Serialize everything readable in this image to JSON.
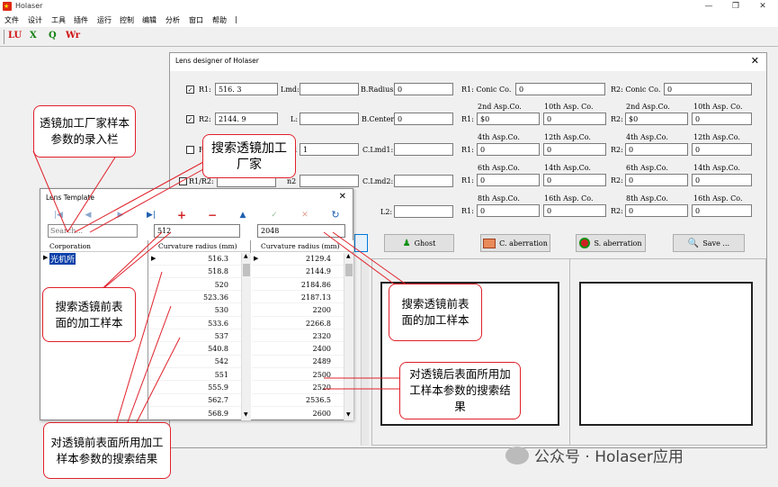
{
  "app": {
    "title": "Holaser"
  },
  "window_controls": {
    "minimize": "—",
    "restore": "❐",
    "close": "✕"
  },
  "menu": [
    "文件",
    "设计",
    "工具",
    "插件",
    "运行",
    "控制",
    "编辑",
    "分析",
    "窗口",
    "帮助",
    "|"
  ],
  "toolbar": [
    {
      "label": "LU",
      "color": "#d01010"
    },
    {
      "label": "X",
      "color": "#108010"
    },
    {
      "label": "Q",
      "color": "#108010"
    },
    {
      "label": "Wr",
      "color": "#d01010"
    }
  ],
  "lens_designer": {
    "title": "Lens designer of Holaser",
    "close": "✕",
    "r1_label": "R1:",
    "r1_value": "516. 3",
    "r1_checked": true,
    "r2_label": "R2:",
    "r2_value": "2144. 9",
    "r2_checked": true,
    "f_label": "F",
    "r1r2_label": "R1/R2:",
    "lmd_label": "Lmd:",
    "l_label": "L:",
    "n1_label": "n1",
    "n1_value": "1",
    "n2_label": "n2",
    "l2_label": "L2:",
    "bradius_label": "B.Radius:",
    "bradius_value": "0",
    "bcenter_label": "B.Center:",
    "bcenter_value": "0",
    "clmd1_label": "C.Lmd1:",
    "clmd2_label": "C.Lmd2:",
    "r1_conic_label": "R1: Conic Co.",
    "r1_conic_value": "0",
    "r2_conic_label": "R2: Conic Co.",
    "r2_conic_value": "0",
    "asp": {
      "r1": "R1:",
      "r2": "R2:",
      "h2": "2nd Asp.Co.",
      "h10": "10th Asp. Co.",
      "h4": "4th Asp.Co.",
      "h12": "12th Asp.Co.",
      "h6": "6th Asp.Co.",
      "h14": "14th Asp.Co.",
      "h8": "8th Asp.Co.",
      "h16": "16th Asp. Co.",
      "v_dollar": "$0",
      "v0": "0"
    },
    "buttons": {
      "ghost": "Ghost",
      "c_aberration": "C. aberration",
      "s_aberration": "S. aberration",
      "save": "Save ..."
    }
  },
  "lens_template": {
    "title": "Lens Template",
    "close": "✕",
    "nav": [
      "|◀",
      "◀",
      "▶",
      "▶|",
      "+",
      "−",
      "▲",
      "✓",
      "✕",
      "↻"
    ],
    "search_placeholder": "Search...",
    "filter1": "512",
    "filter2": "2048",
    "col_corporation": "Corporation",
    "col_front": "Curvature radius (mm)",
    "col_back": "Curvature radius (mm)",
    "corporation_selected": "光机所",
    "front_values": [
      "516.3",
      "518.8",
      "520",
      "523.36",
      "530",
      "533.6",
      "537",
      "540.8",
      "542",
      "551",
      "555.9",
      "562.7",
      "568.9"
    ],
    "back_values": [
      "2129.4",
      "2144.9",
      "2184.86",
      "2187.13",
      "2200",
      "2266.8",
      "2320",
      "2400",
      "2489",
      "2500",
      "2520",
      "2536.5",
      "2600"
    ]
  },
  "callouts": {
    "manufacturer_entry": "透镜加工厂家样本参数的录入栏",
    "search_manufacturer": "搜索透镜加工厂家",
    "search_front_left": "搜索透镜前表面的加工样本",
    "search_front_right": "搜索透镜前表面的加工样本",
    "back_results": "对透镜后表面所用加工样本参数的搜索结果",
    "front_results": "对透镜前表面所用加工样本参数的搜索结果"
  },
  "watermark": "公众号 · Holaser应用"
}
